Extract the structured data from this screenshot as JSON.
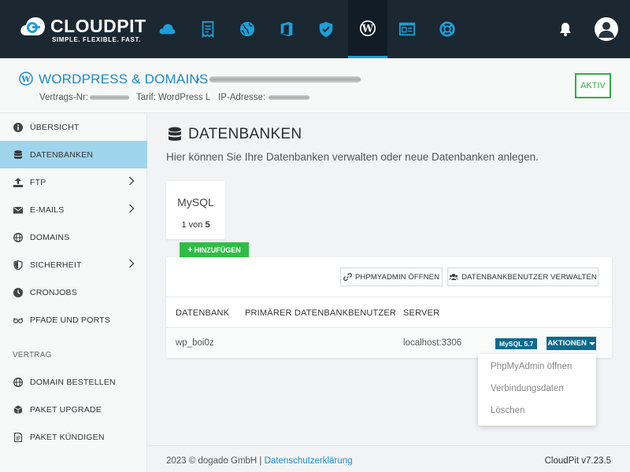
{
  "brand": {
    "name_part1": "CLOUD",
    "name_part2": "PIT",
    "tagline": "SIMPLE. FLEXIBLE. FAST."
  },
  "topnav": {
    "items": [
      {
        "icon": "cloud-icon"
      },
      {
        "icon": "invoice-icon"
      },
      {
        "icon": "globe-icon"
      },
      {
        "icon": "office-icon"
      },
      {
        "icon": "shield-icon"
      },
      {
        "icon": "wordpress-icon",
        "active": true
      },
      {
        "icon": "webpage-icon"
      },
      {
        "icon": "lifebuoy-icon"
      }
    ],
    "bell_icon": "bell-icon",
    "avatar_icon": "user-avatar-icon"
  },
  "header": {
    "title": "WORDPRESS & DOMAINS",
    "contract_label": "Vertrags-Nr:",
    "tarif_label": "Tarif:",
    "tarif_value": "WordPress L",
    "ip_label": "IP-Adresse:",
    "status": "AKTIV"
  },
  "sidebar": {
    "items": [
      {
        "label": "ÜBERSICHT",
        "icon": "info-icon"
      },
      {
        "label": "DATENBANKEN",
        "icon": "database-icon",
        "active": true
      },
      {
        "label": "FTP",
        "icon": "upload-icon",
        "has_submenu": true
      },
      {
        "label": "E-MAILS",
        "icon": "envelope-icon",
        "has_submenu": true
      },
      {
        "label": "DOMAINS",
        "icon": "globe-icon"
      },
      {
        "label": "SICHERHEIT",
        "icon": "shield-icon",
        "has_submenu": true
      },
      {
        "label": "CRONJOBS",
        "icon": "clock-icon"
      },
      {
        "label": "PFADE UND PORTS",
        "icon": "glasses-icon"
      }
    ],
    "section_vertrag": "VERTRAG",
    "contract_items": [
      {
        "label": "DOMAIN BESTELLEN",
        "icon": "globe-icon"
      },
      {
        "label": "PAKET UPGRADE",
        "icon": "cube-icon"
      },
      {
        "label": "PAKET KÜNDIGEN",
        "icon": "document-icon"
      }
    ]
  },
  "main": {
    "title": "DATENBANKEN",
    "subtitle": "Hier können Sie Ihre Datenbanken verwalten oder neue Datenbanken anlegen.",
    "db_card": {
      "name": "MySQL",
      "used": "1",
      "separator": "von",
      "total": "5"
    },
    "add_button": "HINZUFÜGEN",
    "phpmyadmin_button": "PHPMYADMIN ÖFFNEN",
    "users_button": "DATENBANKBENUTZER VERWALTEN",
    "table": {
      "headers": [
        "DATENBANK",
        "PRIMÄRER DATENBANKBENUTZER",
        "SERVER"
      ],
      "rows": [
        {
          "database": "wp_boi0z",
          "primary_user": "",
          "server": "localhost:3306",
          "version": "MySQL 5.7"
        }
      ]
    },
    "actions_button": "AKTIONEN",
    "actions_menu": [
      "PhpMyAdmin öffnen",
      "Verbindungsdaten",
      "Löschen"
    ]
  },
  "footer": {
    "copyright": "2023 © dogado GmbH |",
    "privacy_link": "Datenschutzerklärung",
    "version": "CloudPit v7.23.5"
  },
  "colors": {
    "topbar": "#1b2731",
    "accent": "#1e9fd8",
    "link": "#1b8ccb",
    "active_sidebar": "#9fd5ec",
    "success": "#2ebd44",
    "primary_dark": "#0b6a8e"
  }
}
